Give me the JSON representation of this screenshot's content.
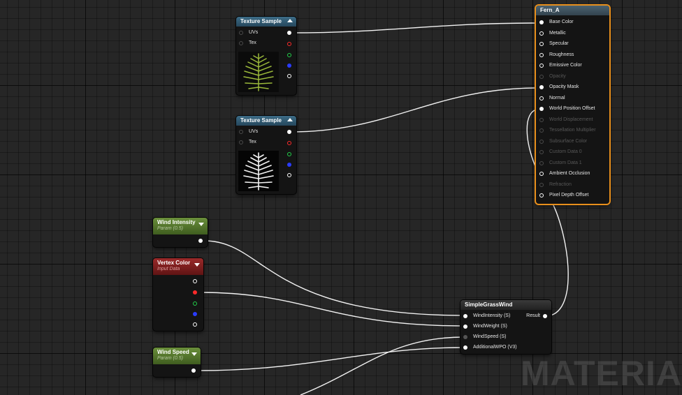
{
  "nodes": {
    "texture_sample_1": {
      "title": "Texture Sample",
      "inputs": [
        "UVs",
        "Tex"
      ],
      "image": "fern-leaf-green"
    },
    "texture_sample_2": {
      "title": "Texture Sample",
      "inputs": [
        "UVs",
        "Tex"
      ],
      "image": "fern-leaf-white-mask"
    },
    "output": {
      "title": "Fern_A",
      "pins": [
        {
          "label": "Base Color",
          "state": "connected"
        },
        {
          "label": "Metallic",
          "state": "open"
        },
        {
          "label": "Specular",
          "state": "open"
        },
        {
          "label": "Roughness",
          "state": "open"
        },
        {
          "label": "Emissive Color",
          "state": "open"
        },
        {
          "label": "Opacity",
          "state": "disabled"
        },
        {
          "label": "Opacity Mask",
          "state": "connected"
        },
        {
          "label": "Normal",
          "state": "open"
        },
        {
          "label": "World Position Offset",
          "state": "connected"
        },
        {
          "label": "World Displacement",
          "state": "disabled"
        },
        {
          "label": "Tessellation Multiplier",
          "state": "disabled"
        },
        {
          "label": "Subsurface Color",
          "state": "disabled"
        },
        {
          "label": "Custom Data 0",
          "state": "disabled"
        },
        {
          "label": "Custom Data 1",
          "state": "disabled"
        },
        {
          "label": "Ambient Occlusion",
          "state": "open"
        },
        {
          "label": "Refraction",
          "state": "disabled"
        },
        {
          "label": "Pixel Depth Offset",
          "state": "open"
        }
      ]
    },
    "wind_intensity": {
      "title": "Wind Intensity",
      "subtitle": "Param (0.5)"
    },
    "vertex_color": {
      "title": "Vertex Color",
      "subtitle": "Input Data"
    },
    "wind_speed": {
      "title": "Wind Speed",
      "subtitle": "Param (0.5)"
    },
    "simple_grass_wind": {
      "title": "SimpleGrassWind",
      "inputs": [
        "WindIntensity (S)",
        "WindWeight (S)",
        "WindSpeed (S)",
        "AdditionalWPO (V3)"
      ],
      "output": "Result"
    }
  },
  "watermark": "MATERIA",
  "colors": {
    "grid_background": "#262626",
    "output_highlight": "#e88f1c",
    "pin_red": "#ff2a2a",
    "pin_green": "#22d14a",
    "pin_blue": "#2a3cff"
  }
}
